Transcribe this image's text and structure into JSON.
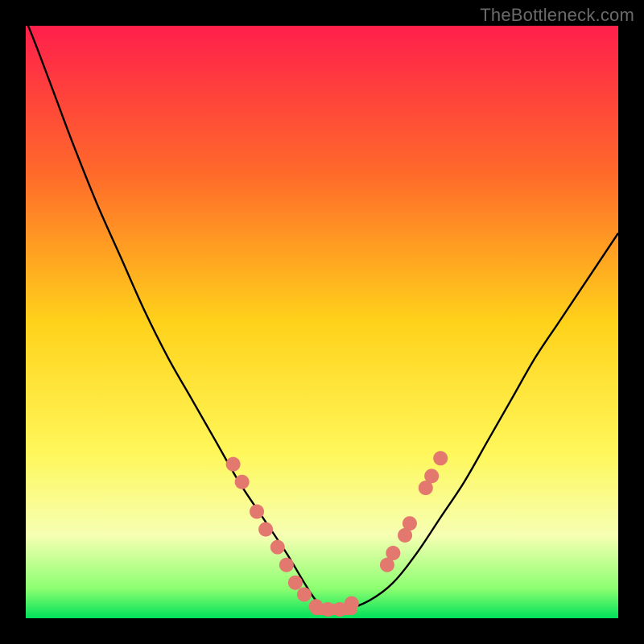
{
  "watermark": "TheBottleneck.com",
  "chart_data": {
    "type": "line",
    "title": "",
    "xlabel": "",
    "ylabel": "",
    "xlim": [
      0,
      100
    ],
    "ylim": [
      0,
      100
    ],
    "background_gradient": {
      "stops": [
        {
          "pct": 0,
          "color": "#ff1f4b"
        },
        {
          "pct": 25,
          "color": "#ff6a2a"
        },
        {
          "pct": 50,
          "color": "#ffd21a"
        },
        {
          "pct": 72,
          "color": "#fff75a"
        },
        {
          "pct": 86,
          "color": "#f6ffb3"
        },
        {
          "pct": 95,
          "color": "#8cff70"
        },
        {
          "pct": 100,
          "color": "#00e05a"
        }
      ]
    },
    "series": [
      {
        "name": "bottleneck-curve",
        "color": "#000000",
        "x": [
          0,
          2,
          5,
          8,
          12,
          16,
          20,
          24,
          28,
          32,
          36,
          40,
          44,
          47,
          49,
          51,
          54,
          58,
          62,
          66,
          70,
          74,
          78,
          82,
          86,
          90,
          94,
          98,
          100
        ],
        "y": [
          101,
          96,
          88,
          80,
          70,
          61,
          52,
          44,
          37,
          30,
          23,
          17,
          11,
          6,
          3,
          1.5,
          1.5,
          3,
          6,
          11,
          17,
          23,
          30,
          37,
          44,
          50,
          56,
          62,
          65
        ]
      }
    ],
    "markers": {
      "name": "highlighted-points",
      "color": "#e2786e",
      "radius": 9,
      "points": [
        {
          "x": 35,
          "y": 26
        },
        {
          "x": 36.5,
          "y": 23
        },
        {
          "x": 39,
          "y": 18
        },
        {
          "x": 40.5,
          "y": 15
        },
        {
          "x": 42.5,
          "y": 12
        },
        {
          "x": 44,
          "y": 9
        },
        {
          "x": 45.5,
          "y": 6
        },
        {
          "x": 47,
          "y": 4
        },
        {
          "x": 49,
          "y": 2
        },
        {
          "x": 51,
          "y": 1.5
        },
        {
          "x": 53,
          "y": 1.5
        },
        {
          "x": 55,
          "y": 2.5
        },
        {
          "x": 61,
          "y": 9
        },
        {
          "x": 62,
          "y": 11
        },
        {
          "x": 64,
          "y": 14
        },
        {
          "x": 64.8,
          "y": 16
        },
        {
          "x": 67.5,
          "y": 22
        },
        {
          "x": 68.5,
          "y": 24
        },
        {
          "x": 70,
          "y": 27
        }
      ]
    },
    "flat_segment": {
      "x_start": 49,
      "x_end": 55,
      "y": 1.5,
      "stroke_width": 14,
      "color": "#e2786e"
    }
  }
}
